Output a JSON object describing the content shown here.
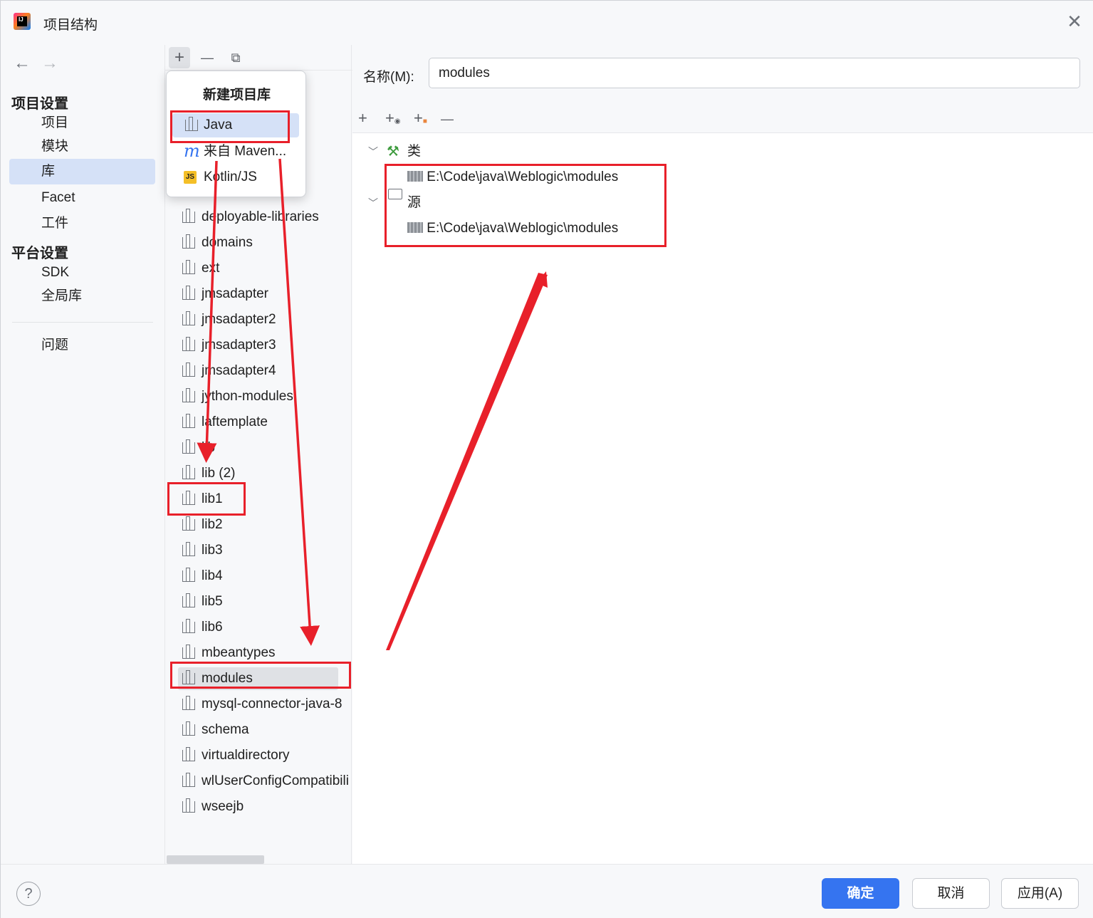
{
  "window": {
    "title": "项目结构",
    "close_icon": "close-icon"
  },
  "nav": {
    "back_icon": "←",
    "forward_icon": "→",
    "section_project": "项目设置",
    "items_project": [
      {
        "label": "项目"
      },
      {
        "label": "模块"
      },
      {
        "label": "库"
      },
      {
        "label": "Facet"
      },
      {
        "label": "工件"
      }
    ],
    "section_platform": "平台设置",
    "items_platform": [
      {
        "label": "SDK"
      },
      {
        "label": "全局库"
      }
    ],
    "problems": "问题",
    "selected": "库"
  },
  "list_toolbar": {
    "add": "+",
    "remove": "—",
    "copy": "⧉"
  },
  "popup": {
    "title": "新建项目库",
    "items": [
      {
        "label": "Java",
        "icon": "library-icon"
      },
      {
        "label": "来自 Maven...",
        "icon": "maven-icon"
      },
      {
        "label": "Kotlin/JS",
        "icon": "kotlin-js-icon"
      }
    ]
  },
  "libraries": [
    "deployable-libraries",
    "domains",
    "ext",
    "jmsadapter",
    "jmsadapter2",
    "jmsadapter3",
    "jmsadapter4",
    "jython-modules",
    "laftemplate",
    "lib",
    "lib (2)",
    "lib1",
    "lib2",
    "lib3",
    "lib4",
    "lib5",
    "lib6",
    "mbeantypes",
    "modules",
    "mysql-connector-java-8",
    "schema",
    "virtualdirectory",
    "wlUserConfigCompatibility",
    "wseejb"
  ],
  "selected_library": "modules",
  "detail": {
    "name_label": "名称(M):",
    "name_value": "modules",
    "toolbar": {
      "add": "+",
      "add_url": "+",
      "add_folder": "+",
      "remove": "—"
    },
    "classes_label": "类",
    "classes_path": "E:\\Code\\java\\Weblogic\\modules",
    "sources_label": "源",
    "sources_path": "E:\\Code\\java\\Weblogic\\modules"
  },
  "footer": {
    "help": "?",
    "ok": "确定",
    "cancel": "取消",
    "apply": "应用(A)"
  },
  "colors": {
    "accent": "#3574f0",
    "selection": "#d5e1f7",
    "annotation": "#e8202a"
  }
}
